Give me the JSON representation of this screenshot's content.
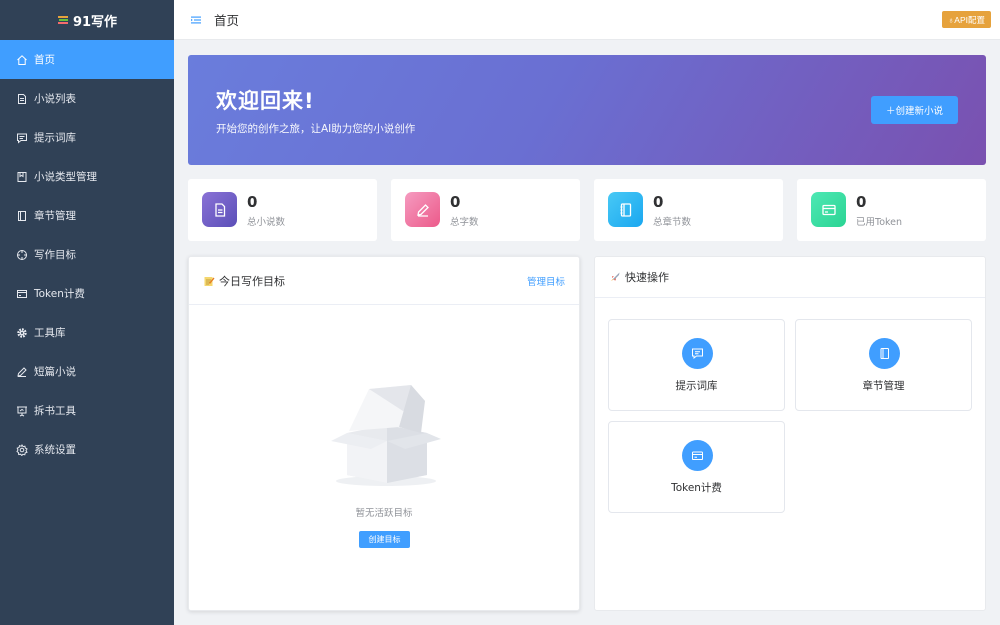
{
  "app": {
    "name": "91写作"
  },
  "sidebar": {
    "items": [
      {
        "label": "首页",
        "icon": "home-icon",
        "active": true
      },
      {
        "label": "小说列表",
        "icon": "document-icon"
      },
      {
        "label": "提示词库",
        "icon": "chat-icon"
      },
      {
        "label": "小说类型管理",
        "icon": "bookmark-icon"
      },
      {
        "label": "章节管理",
        "icon": "notebook-icon"
      },
      {
        "label": "写作目标",
        "icon": "target-icon"
      },
      {
        "label": "Token计费",
        "icon": "card-icon"
      },
      {
        "label": "工具库",
        "icon": "gear-icon"
      },
      {
        "label": "短篇小说",
        "icon": "pen-icon"
      },
      {
        "label": "拆书工具",
        "icon": "presentation-icon"
      },
      {
        "label": "系统设置",
        "icon": "settings-icon"
      }
    ]
  },
  "header": {
    "title": "首页",
    "api_button": "♁API配置"
  },
  "banner": {
    "title": "欢迎回来!",
    "subtitle": "开始您的创作之旅，让AI助力您的小说创作",
    "button": "＋创建新小说"
  },
  "stats": [
    {
      "value": "0",
      "label": "总小说数",
      "icon": "document-icon",
      "gradient": [
        "#8a72d6",
        "#5b4fb8"
      ]
    },
    {
      "value": "0",
      "label": "总字数",
      "icon": "pen-icon",
      "gradient": [
        "#f59bc0",
        "#ec5a8a"
      ]
    },
    {
      "value": "0",
      "label": "总章节数",
      "icon": "notebook-icon",
      "gradient": [
        "#48c9f5",
        "#1aa7f0"
      ]
    },
    {
      "value": "0",
      "label": "已用Token",
      "icon": "card-icon",
      "gradient": [
        "#4de8b4",
        "#2bd493"
      ]
    }
  ],
  "goal_panel": {
    "title": "今日写作目标",
    "manage_link": "管理目标",
    "empty_text": "暂无活跃目标",
    "create_button": "创建目标"
  },
  "quick_panel": {
    "title": "快速操作",
    "actions": [
      {
        "label": "提示词库",
        "icon": "chat-icon"
      },
      {
        "label": "章节管理",
        "icon": "notebook-icon"
      },
      {
        "label": "Token计费",
        "icon": "card-icon"
      }
    ]
  },
  "colors": {
    "sidebar_bg": "#304156",
    "primary": "#409eff",
    "warning": "#e6a23c"
  }
}
